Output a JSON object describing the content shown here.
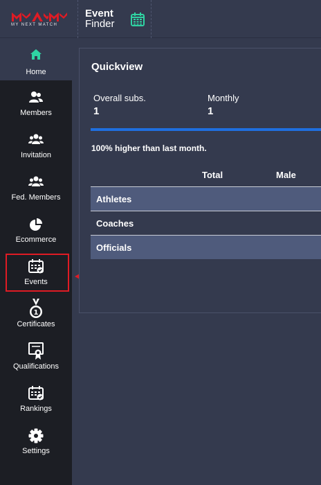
{
  "header": {
    "logo_text": "MAM",
    "logo_sub": "MY NEXT MATCH",
    "title_line1": "Event",
    "title_line2": "Finder",
    "calendar_icon": "calendar-icon",
    "brand_color": "#e01b24",
    "accent_color": "#2fd4a3"
  },
  "sidebar": {
    "items": [
      {
        "label": "Home",
        "icon": "home-icon",
        "active": true
      },
      {
        "label": "Members",
        "icon": "users-icon"
      },
      {
        "label": "Invitation",
        "icon": "users-group-icon"
      },
      {
        "label": "Fed. Members",
        "icon": "users-group-icon"
      },
      {
        "label": "Ecommerce",
        "icon": "pie-chart-icon"
      },
      {
        "label": "Events",
        "icon": "calendar-check-icon",
        "highlighted": true
      },
      {
        "label": "Certificates",
        "icon": "medal-icon"
      },
      {
        "label": "Qualifications",
        "icon": "certificate-icon"
      },
      {
        "label": "Rankings",
        "icon": "calendar-check-icon"
      },
      {
        "label": "Settings",
        "icon": "gear-icon"
      }
    ]
  },
  "quickview": {
    "title": "Quickview",
    "overall_label": "Overall subs.",
    "overall_value": "1",
    "monthly_label": "Monthly",
    "monthly_value": "1",
    "comparison_text": "100% higher than last month.",
    "columns": [
      "",
      "Total",
      "Male"
    ],
    "rows": [
      "Athletes",
      "Coaches",
      "Officials"
    ],
    "progress_percent": 100,
    "progress_color": "#1f6fe0"
  }
}
